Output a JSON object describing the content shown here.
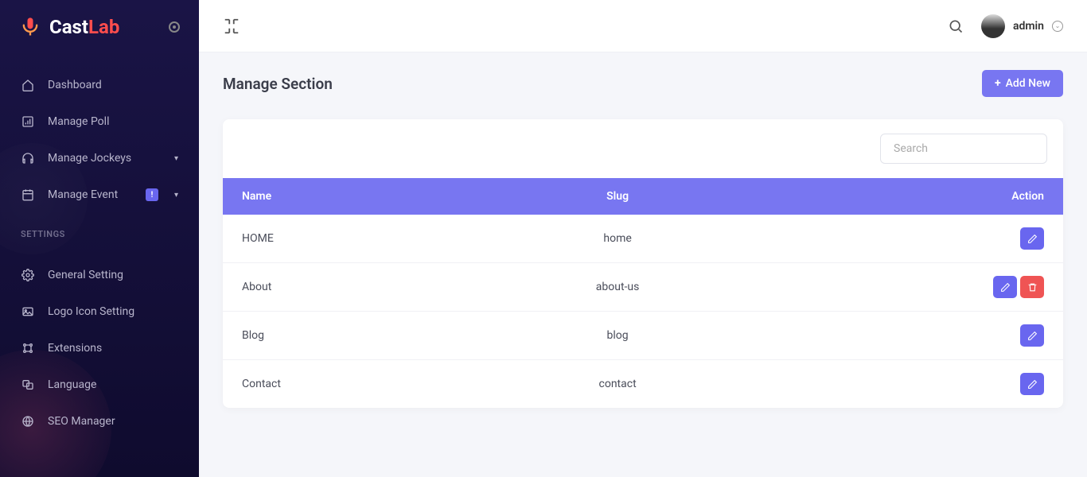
{
  "brand": {
    "name_a": "Cast",
    "name_b": "Lab"
  },
  "sidebar": {
    "items": [
      {
        "label": "Dashboard"
      },
      {
        "label": "Manage Poll"
      },
      {
        "label": "Manage Jockeys"
      },
      {
        "label": "Manage Event",
        "badge": "!"
      }
    ],
    "settings_heading": "SETTINGS",
    "settings": [
      {
        "label": "General Setting"
      },
      {
        "label": "Logo Icon Setting"
      },
      {
        "label": "Extensions"
      },
      {
        "label": "Language"
      },
      {
        "label": "SEO Manager"
      }
    ]
  },
  "header": {
    "user_name": "admin"
  },
  "page": {
    "title": "Manage Section",
    "add_label": "Add New",
    "search_placeholder": "Search",
    "columns": {
      "name": "Name",
      "slug": "Slug",
      "action": "Action"
    },
    "rows": [
      {
        "name": "HOME",
        "slug": "home",
        "deletable": false
      },
      {
        "name": "About",
        "slug": "about-us",
        "deletable": true
      },
      {
        "name": "Blog",
        "slug": "blog",
        "deletable": false
      },
      {
        "name": "Contact",
        "slug": "contact",
        "deletable": false
      }
    ]
  }
}
